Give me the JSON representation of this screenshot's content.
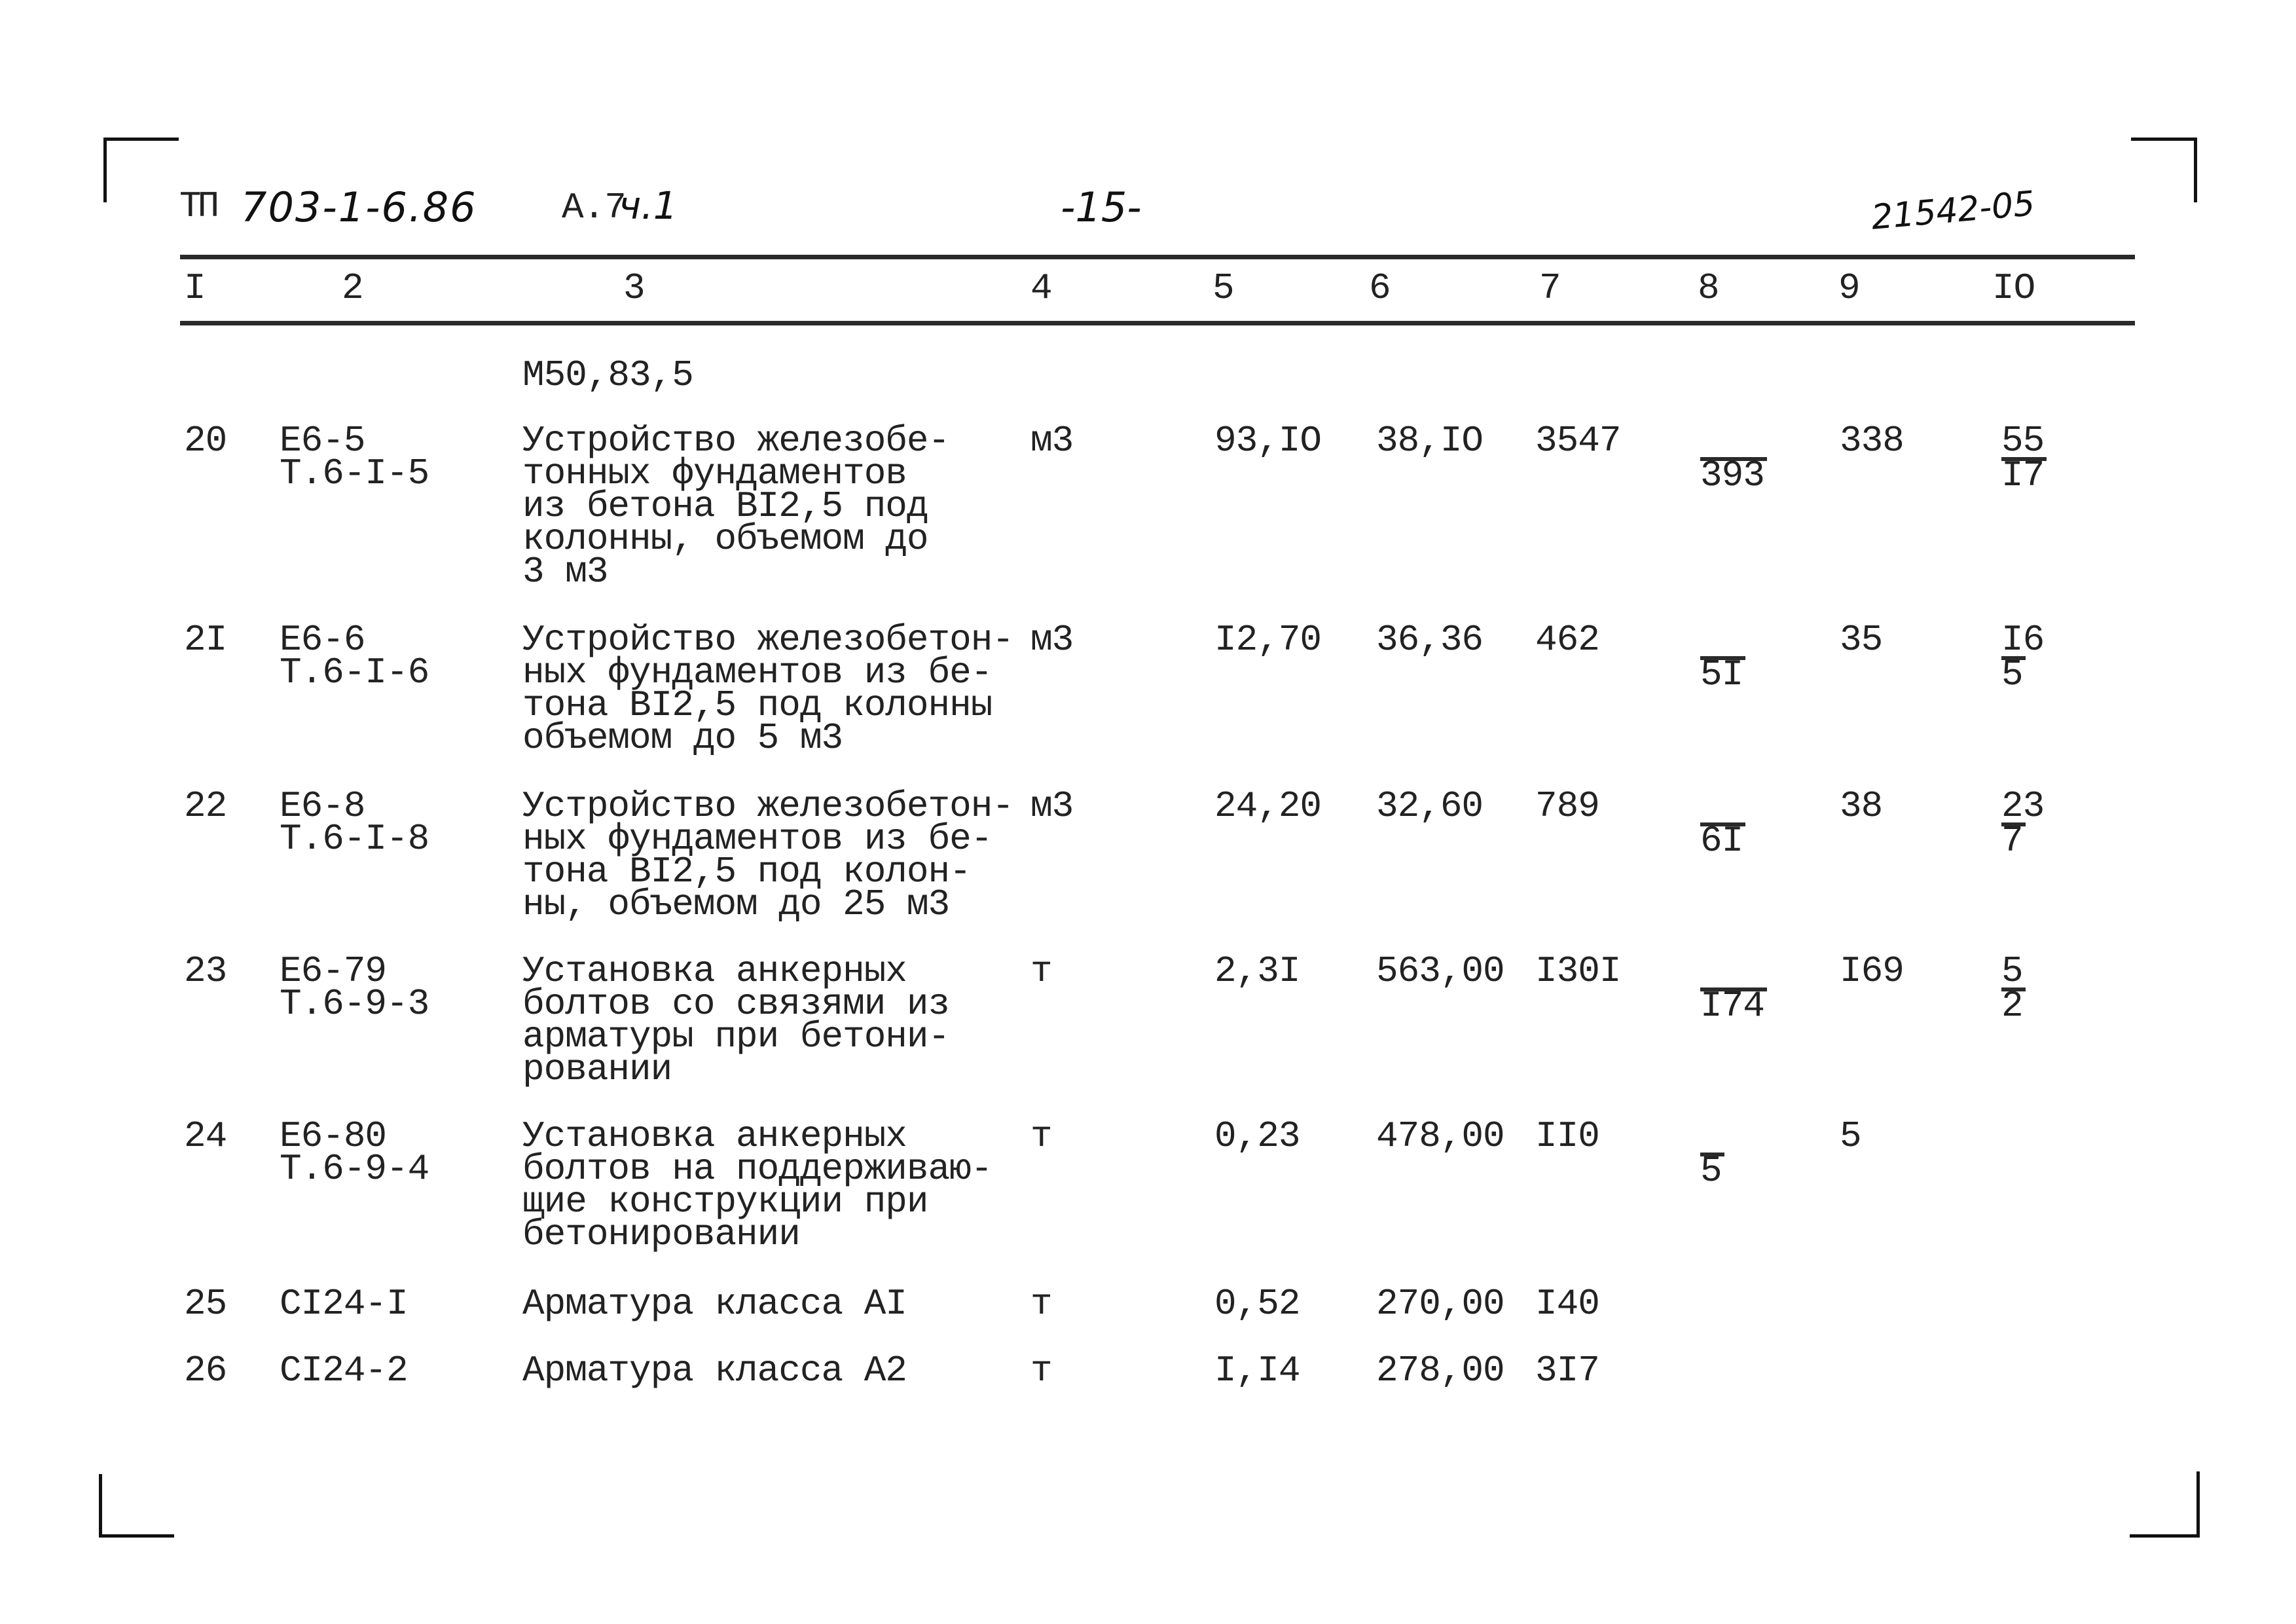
{
  "header": {
    "doc_prefix": "ТП",
    "doc_number": "703-1-6.86",
    "album": "А.7",
    "part": "ч.1",
    "page": "-15-",
    "inventory_number": "21542-05"
  },
  "columns": [
    "I",
    "2",
    "3",
    "4",
    "5",
    "6",
    "7",
    "8",
    "9",
    "IO"
  ],
  "carry_over_text": "М50,83,5",
  "rows": [
    {
      "num": "20",
      "code": [
        "Е6-5",
        "Т.6-I-5"
      ],
      "description": [
        "Устройство железобе-",
        "тонных фундаментов",
        "из бетона ВI2,5 под",
        "колонны, объемом до",
        "3 м3"
      ],
      "unit": "м3",
      "quantity": "93,IO",
      "unit_price": "38,IO",
      "total": "3547",
      "col8": {
        "num": "",
        "den": "393"
      },
      "col9": "338",
      "col10": {
        "num": "55",
        "den": "I7"
      }
    },
    {
      "num": "2I",
      "code": [
        "Е6-6",
        "Т.6-I-6"
      ],
      "description": [
        "Устройство железобетон-",
        "ных фундаментов из бе-",
        "тона ВI2,5 под колонны",
        "объемом до 5 м3"
      ],
      "unit": "м3",
      "quantity": "I2,70",
      "unit_price": "36,36",
      "total": "462",
      "col8": {
        "num": "",
        "den": "5I"
      },
      "col9": "35",
      "col10": {
        "num": "I6",
        "den": "5"
      }
    },
    {
      "num": "22",
      "code": [
        "Е6-8",
        "Т.6-I-8"
      ],
      "description": [
        "Устройство железобетон-",
        "ных фундаментов из бе-",
        "тона ВI2,5 под колон-",
        "ны, объемом до 25 м3"
      ],
      "unit": "м3",
      "quantity": "24,20",
      "unit_price": "32,60",
      "total": "789",
      "col8": {
        "num": "",
        "den": "6I"
      },
      "col9": "38",
      "col10": {
        "num": "23",
        "den": "7"
      }
    },
    {
      "num": "23",
      "code": [
        "Е6-79",
        "Т.6-9-3"
      ],
      "description": [
        "Установка анкерных",
        "болтов со связями из",
        "арматуры при бетони-",
        "ровании"
      ],
      "unit": "т",
      "quantity": "2,3I",
      "unit_price": "563,00",
      "total": "I30I",
      "col8": {
        "num": "",
        "den": "I74"
      },
      "col9": "I69",
      "col10": {
        "num": "5",
        "den": "2"
      }
    },
    {
      "num": "24",
      "code": [
        "Е6-80",
        "Т.6-9-4"
      ],
      "description": [
        "Установка анкерных",
        "болтов на поддерживаю-",
        "щие конструкции при",
        "бетонировании"
      ],
      "unit": "т",
      "quantity": "0,23",
      "unit_price": "478,00",
      "total": "II0",
      "col8": {
        "num": "",
        "den": "5"
      },
      "col9": "5",
      "col10": null
    },
    {
      "num": "25",
      "code": [
        "СI24-I"
      ],
      "description": [
        "Арматура класса АI"
      ],
      "unit": "т",
      "quantity": "0,52",
      "unit_price": "270,00",
      "total": "I40",
      "col8": null,
      "col9": "",
      "col10": null
    },
    {
      "num": "26",
      "code": [
        "СI24-2"
      ],
      "description": [
        "Арматура класса А2"
      ],
      "unit": "т",
      "quantity": "I,I4",
      "unit_price": "278,00",
      "total": "3I7",
      "col8": null,
      "col9": "",
      "col10": null
    }
  ]
}
